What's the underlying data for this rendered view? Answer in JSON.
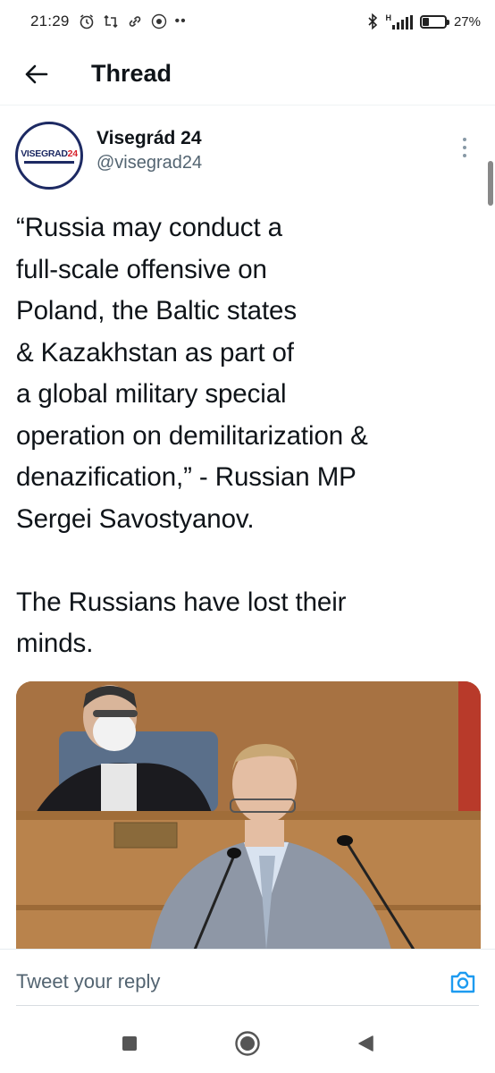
{
  "status_bar": {
    "time": "21:29",
    "network": "H",
    "battery_percent": "27%",
    "battery_level": 0.27
  },
  "header": {
    "back_icon": "arrow-left-icon",
    "title": "Thread"
  },
  "tweet": {
    "author": {
      "name": "Visegrád 24",
      "handle": "@visegrad24",
      "avatar_text_main": "VISEGRAD",
      "avatar_text_num": "24"
    },
    "more_icon": "vertical-dots-icon",
    "text": "“Russia may conduct a\nfull-scale offensive on\nPoland, the Baltic states\n& Kazakhstan as part of\na global military special\noperation on demilitarization &\ndenazification,” - Russian MP\nSergei Savostyanov.\n\nThe Russians have lost their\nminds.",
    "image_icon": "photo-of-speaker-at-podium"
  },
  "reply": {
    "placeholder": "Tweet your reply",
    "camera_icon": "camera-icon"
  },
  "nav": {
    "recents_icon": "square-icon",
    "home_icon": "circle-icon",
    "back_icon": "triangle-back-icon"
  },
  "colors": {
    "accent": "#1d9bf0",
    "text": "#0f1419",
    "secondary_text": "#536471",
    "avatar_navy": "#1d2a63",
    "avatar_red": "#d6202a"
  }
}
